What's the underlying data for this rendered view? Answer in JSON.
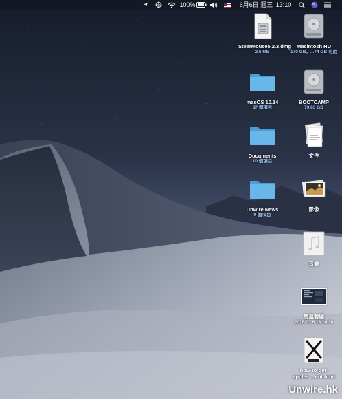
{
  "menubar": {
    "battery_percent": "100%",
    "date": "6月6日 週三",
    "time": "13:10",
    "icons": [
      "location-arrow-icon",
      "cursor-icon",
      "wifi-icon",
      "battery-icon",
      "volume-icon",
      "flag-icon",
      "search-icon",
      "siri-icon",
      "notification-icon"
    ]
  },
  "desktop": {
    "items": [
      {
        "name": "SteerMouse5.2.3.dmg",
        "meta": "2.6 MB",
        "icon": "disk-image-icon"
      },
      {
        "name": "Macintosh HD",
        "meta": "170 GB，...74 GB 可用",
        "icon": "hard-drive-icon"
      },
      {
        "name": "macOS 10.14",
        "meta": "37 個項目",
        "icon": "folder-icon"
      },
      {
        "name": "BOOTCAMP",
        "meta": "79.83 GB",
        "icon": "hard-drive-icon"
      },
      {
        "name": "Documents",
        "meta": "10 個項目",
        "icon": "folder-icon"
      },
      {
        "name": "文件",
        "meta": "",
        "icon": "documents-stack-icon"
      },
      {
        "name": "Unwire News",
        "meta": "9 個項目",
        "icon": "folder-icon"
      },
      {
        "name": "影像",
        "meta": "",
        "icon": "photos-stack-icon"
      },
      {
        "name": "音樂",
        "meta": "",
        "icon": "music-file-icon"
      },
      {
        "name": "螢幕截圖",
        "meta": "2018-0...6 13.10.16",
        "icon": "screenshot-icon"
      },
      {
        "name": "how-to-get-apples-...ent.html",
        "meta": "",
        "icon": "html-file-icon"
      }
    ]
  },
  "watermark": "Unwire.hk",
  "colors": {
    "sky_top": "#1b2233",
    "sky_bottom": "#4a5671",
    "dune_light": "#c7cbd6",
    "dune_shadow": "#2d3445",
    "folder_blue": "#5aaee6",
    "meta_blue": "#9fc4f2"
  }
}
